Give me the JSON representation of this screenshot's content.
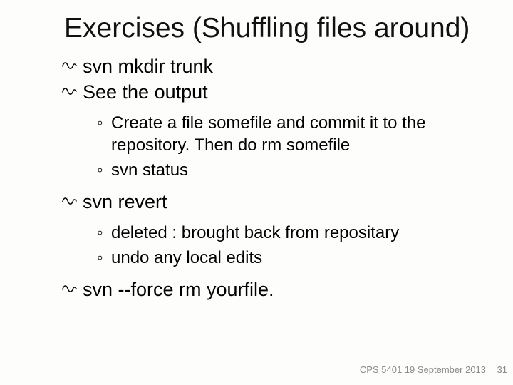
{
  "title": "Exercises (Shuffling files around)",
  "items": {
    "b1": "svn mkdir trunk",
    "b2": "See the output",
    "s1": "Create a file somefile and commit it to the repository. Then do rm somefile",
    "s2": "svn status",
    "b3": "svn revert",
    "s3": " deleted : brought back from repositary",
    "s4": "undo any local edits",
    "b4": "svn --force rm yourfile."
  },
  "footer": "CPS 5401  19 September 2013",
  "page": "31",
  "icons": {
    "scribble": "scribble-icon"
  }
}
